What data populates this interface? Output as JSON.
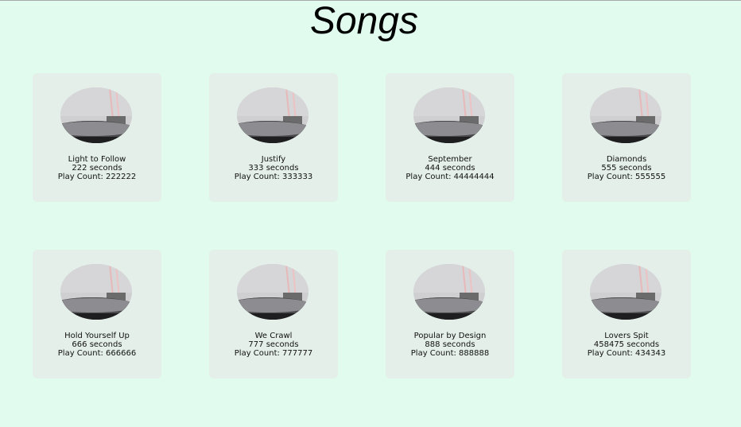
{
  "page": {
    "title": "Songs",
    "background_color": "#e1fcef",
    "card_color": "#e3efe8"
  },
  "songs": [
    {
      "title": "Light to Follow",
      "duration": "222 seconds",
      "play_count": "Play Count: 222222",
      "image": "record-player-icon"
    },
    {
      "title": "Justify",
      "duration": "333 seconds",
      "play_count": "Play Count: 333333",
      "image": "record-player-icon"
    },
    {
      "title": "September",
      "duration": "444 seconds",
      "play_count": "Play Count: 44444444",
      "image": "record-player-icon"
    },
    {
      "title": "Diamonds",
      "duration": "555 seconds",
      "play_count": "Play Count: 555555",
      "image": "record-player-icon"
    },
    {
      "title": "Hold Yourself Up",
      "duration": "666 seconds",
      "play_count": "Play Count: 666666",
      "image": "record-player-icon"
    },
    {
      "title": "We Crawl",
      "duration": "777 seconds",
      "play_count": "Play Count: 777777",
      "image": "record-player-icon"
    },
    {
      "title": "Popular by Design",
      "duration": "888 seconds",
      "play_count": "Play Count: 888888",
      "image": "record-player-icon"
    },
    {
      "title": "Lovers Spit",
      "duration": "458475 seconds",
      "play_count": "Play Count: 434343",
      "image": "record-player-icon"
    }
  ]
}
